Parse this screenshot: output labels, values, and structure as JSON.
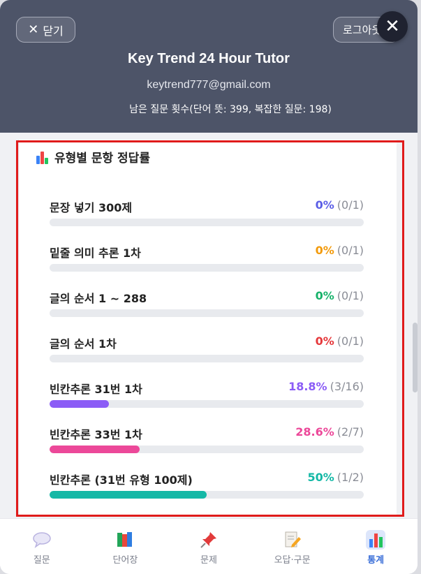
{
  "header": {
    "close_label": "닫기",
    "logout_label": "로그아웃",
    "title": "Key Trend 24 Hour Tutor",
    "email": "keytrend777@gmail.com",
    "remaining": "남은 질문 횟수(단어 뜻: 399, 복잡한 질문: 198)"
  },
  "section": {
    "title": "유형별 문항 정답률",
    "icon": "bar-chart-icon"
  },
  "stats": [
    {
      "label": "문장 넣기 300제",
      "pct": "0%",
      "count": "(0/1)",
      "fraction": 0,
      "color": "#5b5ee6"
    },
    {
      "label": "밑줄 의미 추론 1차",
      "pct": "0%",
      "count": "(0/1)",
      "fraction": 0,
      "color": "#f29a0b"
    },
    {
      "label": "글의 순서 1 ~ 288",
      "pct": "0%",
      "count": "(0/1)",
      "fraction": 0,
      "color": "#17b26a"
    },
    {
      "label": "글의 순서 1차",
      "pct": "0%",
      "count": "(0/1)",
      "fraction": 0,
      "color": "#e5383b"
    },
    {
      "label": "빈칸추론 31번 1차",
      "pct": "18.8%",
      "count": "(3/16)",
      "fraction": 0.188,
      "color": "#8b5cf6"
    },
    {
      "label": "빈칸추론 33번 1차",
      "pct": "28.6%",
      "count": "(2/7)",
      "fraction": 0.286,
      "color": "#ec4899"
    },
    {
      "label": "빈칸추론 (31번 유형 100제)",
      "pct": "50%",
      "count": "(1/2)",
      "fraction": 0.5,
      "color": "#14b8a6"
    }
  ],
  "nav": [
    {
      "label": "질문",
      "icon": "speech-bubble-icon"
    },
    {
      "label": "단어장",
      "icon": "books-icon"
    },
    {
      "label": "문제",
      "icon": "pushpin-icon"
    },
    {
      "label": "오답·구문",
      "icon": "memo-icon"
    },
    {
      "label": "통계",
      "icon": "bar-chart-icon",
      "active": true
    }
  ]
}
